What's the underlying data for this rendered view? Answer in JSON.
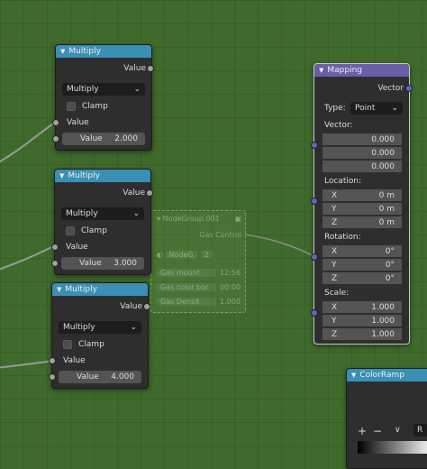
{
  "nodes": {
    "multiply1": {
      "title": "Multiply",
      "output_label": "Value",
      "operation": "Multiply",
      "clamp_label": "Clamp",
      "input_label": "Value",
      "value_label": "Value",
      "value": "2.000"
    },
    "multiply2": {
      "title": "Multiply",
      "output_label": "Value",
      "operation": "Multiply",
      "clamp_label": "Clamp",
      "input_label": "Value",
      "value_label": "Value",
      "value": "3.000"
    },
    "multiply3": {
      "title": "Multiply",
      "output_label": "Value",
      "operation": "Multiply",
      "clamp_label": "Clamp",
      "input_label": "Value",
      "value_label": "Value",
      "value": "4.000"
    },
    "mapping": {
      "title": "Mapping",
      "output_label": "Vector",
      "type_label": "Type:",
      "type_value": "Point",
      "vector_label": "Vector:",
      "vector": [
        "0.000",
        "0.000",
        "0.000"
      ],
      "location_label": "Location:",
      "location": [
        {
          "axis": "X",
          "value": "0 m"
        },
        {
          "axis": "Y",
          "value": "0 m"
        },
        {
          "axis": "Z",
          "value": "0 m"
        }
      ],
      "rotation_label": "Rotation:",
      "rotation": [
        {
          "axis": "X",
          "value": "0°"
        },
        {
          "axis": "Y",
          "value": "0°"
        },
        {
          "axis": "Z",
          "value": "0°"
        }
      ],
      "scale_label": "Scale:",
      "scale": [
        {
          "axis": "X",
          "value": "1.000"
        },
        {
          "axis": "Y",
          "value": "1.000"
        },
        {
          "axis": "Z",
          "value": "1.000"
        }
      ]
    },
    "colorramp": {
      "title": "ColorRamp",
      "add": "+",
      "remove": "−",
      "chevron": "∨",
      "interp_partial": "R"
    },
    "ghost_group": {
      "title": "NodeGroup.001",
      "output_label": "Gas Control",
      "datablock": "NodeG",
      "users": "2",
      "rows": [
        {
          "label": "Gas mount",
          "value": "12:56"
        },
        {
          "label": "Gas color bor",
          "value": "00:00"
        },
        {
          "label": "Gas Densit",
          "value": "1.000"
        }
      ]
    }
  },
  "colors": {
    "canvas": "#3f6a2c",
    "header_math": "#3a8fb5",
    "header_vector": "#6b5ea8",
    "socket_float": "#a1a1a1",
    "socket_vector": "#6363c7"
  },
  "icons": {
    "collapse": "chevron-down-icon",
    "dropdown": "chevron-down-icon",
    "checkbox": "checkbox-icon"
  }
}
